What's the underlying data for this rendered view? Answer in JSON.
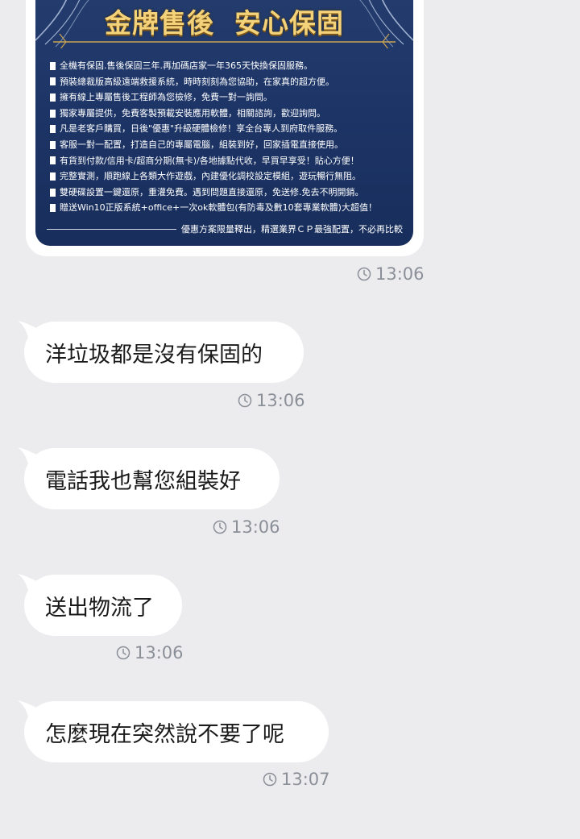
{
  "image_message": {
    "title": "金牌售後  安心保固",
    "items": [
      "全機有保固.售後保固三年.再加碼店家一年365天快換保固服務。",
      "預裝總裁版高級遠端救援系統，時時刻刻為您協助，在家真的超方便。",
      "擁有線上專屬售後工程師為您檢修，免費一對一詢問。",
      "獨家專屬提供，免費客製預載安裝應用軟體，相關諮詢，歡迎詢問。",
      "凡是老客戶購買，日後\"優惠\"升級硬體檢修！享全台專人到府取件服務。",
      "客服一對一配置，打造自己的專屬電腦，組裝到好，回家插電直接使用。",
      "有貨到付款/信用卡/超商分期(無卡)/各地據點代收，早買早享受！貼心方便！",
      "完整實測，順跑線上各類大作遊戲，內建優化調校設定模組，遊玩暢行無阻。",
      "雙硬碟設置一鍵還原，重灌免費。遇到問題直接還原，免送修.免去不明開銷。",
      "贈送Win10正版系統+office+一次ok軟體包(有防毒及數10套專業軟體)大超值！"
    ],
    "footer": "優惠方案限量釋出，精選業界ＣＰ最強配置，不必再比較",
    "timestamp": "13:06"
  },
  "messages": [
    {
      "text": "洋垃圾都是沒有保固的",
      "time": "13:06"
    },
    {
      "text": "電話我也幫您組裝好",
      "time": "13:06"
    },
    {
      "text": "送出物流了",
      "time": "13:06"
    },
    {
      "text": "怎麼現在突然說不要了呢",
      "time": "13:07"
    }
  ],
  "colors": {
    "background": "#ececee",
    "bubble": "#ffffff",
    "promo_bg": "#1d3567",
    "promo_title": "#f3d27a",
    "timestamp": "#8b8f98"
  },
  "icons": {
    "timestamp": "clock-icon"
  }
}
